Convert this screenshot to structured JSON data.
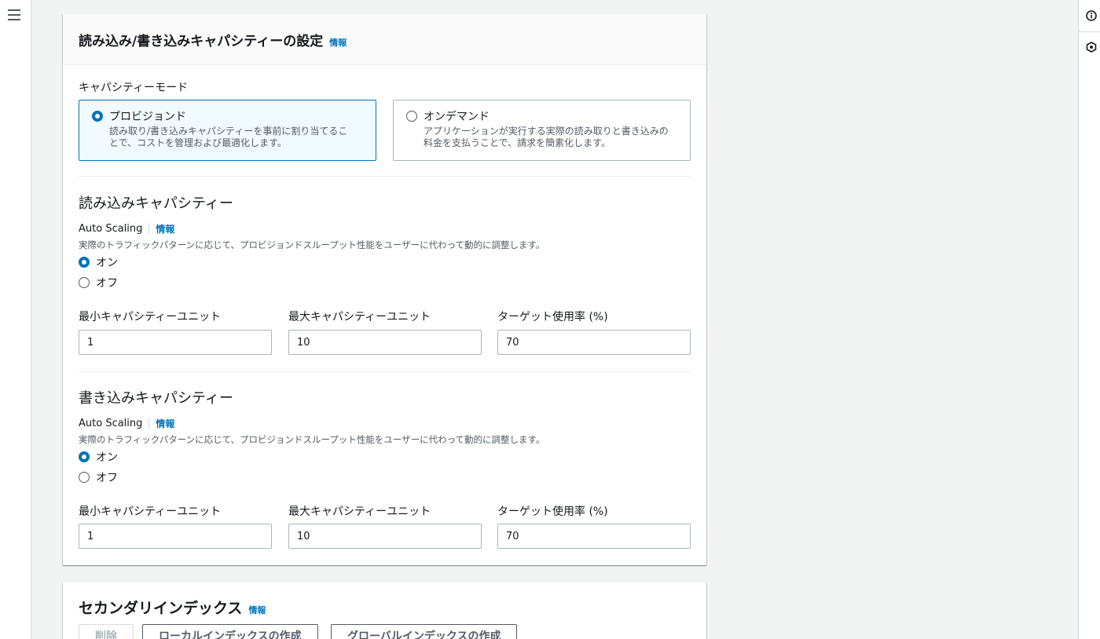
{
  "capacity": {
    "title": "読み込み/書き込みキャパシティーの設定",
    "info": "情報",
    "mode_label": "キャパシティーモード",
    "modes": [
      {
        "title": "プロビジョンド",
        "desc_line1": "読み取り/書き込みキャパシティーを事前に割り当てるこ",
        "desc_line2": "とで、コストを管理および最適化します。",
        "selected": true
      },
      {
        "title": "オンデマンド",
        "desc_line1": "アプリケーションが実行する実際の読み取りと書き込みの",
        "desc_line2": "料金を支払うことで、請求を簡素化します。",
        "selected": false
      }
    ],
    "read": {
      "title": "読み込みキャパシティー",
      "auto_scaling_label": "Auto Scaling",
      "info": "情報",
      "desc": "実際のトラフィックパターンに応じて、プロビジョンドスループット性能をユーザーに代わって動的に調整します。",
      "on_label": "オン",
      "off_label": "オフ",
      "min_label": "最小キャパシティーユニット",
      "min_value": "1",
      "max_label": "最大キャパシティーユニット",
      "max_value": "10",
      "target_label": "ターゲット使用率 (%)",
      "target_value": "70"
    },
    "write": {
      "title": "書き込みキャパシティー",
      "auto_scaling_label": "Auto Scaling",
      "info": "情報",
      "desc": "実際のトラフィックパターンに応じて、プロビジョンドスループット性能をユーザーに代わって動的に調整します。",
      "on_label": "オン",
      "off_label": "オフ",
      "min_label": "最小キャパシティーユニット",
      "min_value": "1",
      "max_label": "最大キャパシティーユニット",
      "max_value": "10",
      "target_label": "ターゲット使用率 (%)",
      "target_value": "70"
    }
  },
  "secondary": {
    "title": "セカンダリインデックス",
    "info": "情報",
    "delete_label": "削除",
    "local_label": "ローカルインデックスの作成",
    "global_label": "グローバルインデックスの作成"
  },
  "icons": {
    "menu": "hamburger-menu-icon",
    "info": "info-circle-icon",
    "notifications": "hexagon-icon"
  }
}
